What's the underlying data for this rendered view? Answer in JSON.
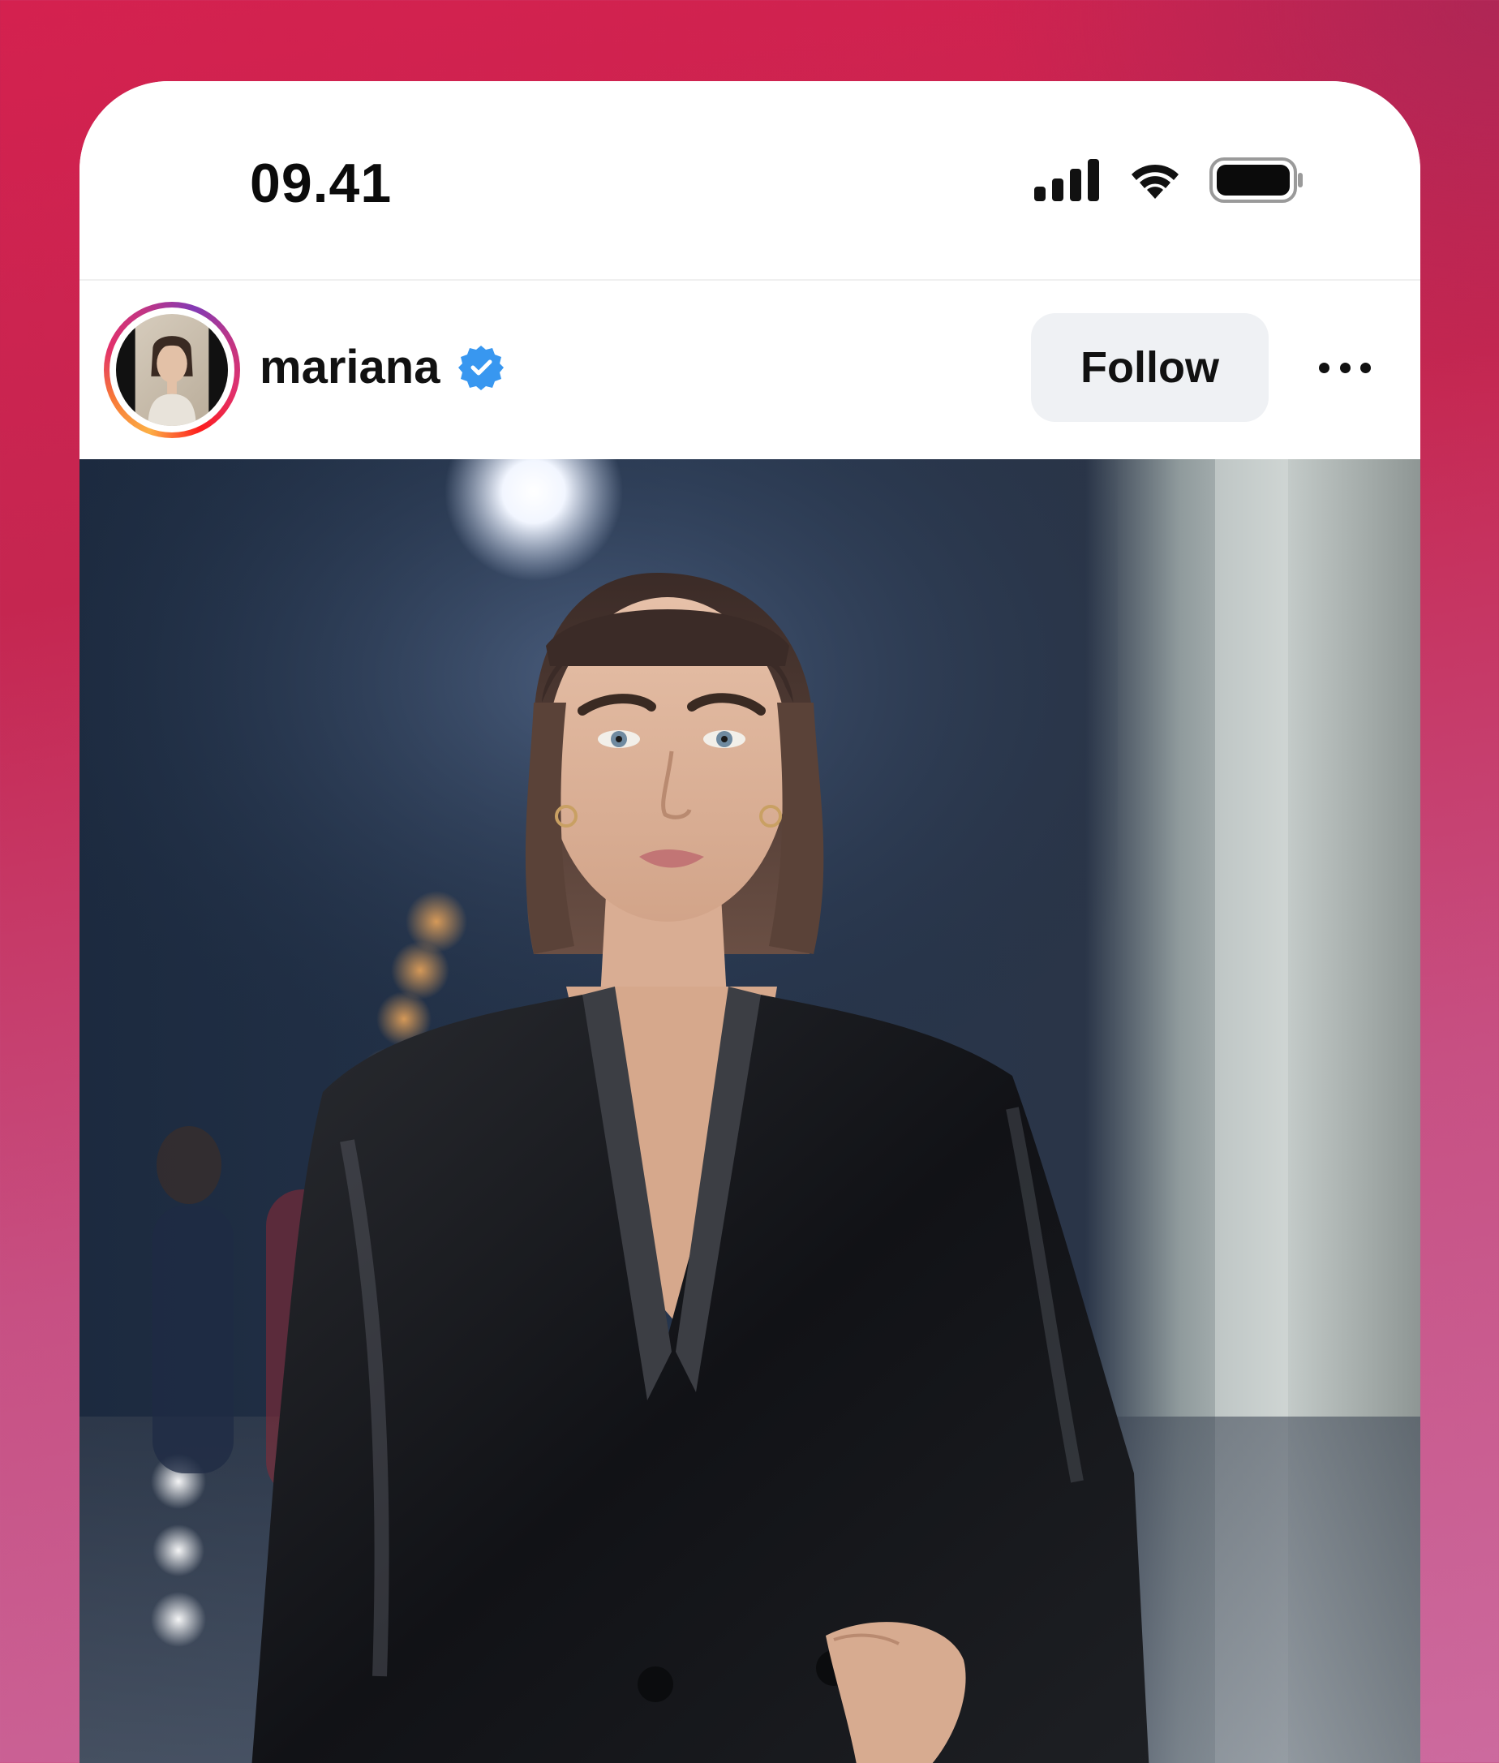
{
  "status_bar": {
    "time": "09.41",
    "icons": [
      "cellular-signal-icon",
      "wifi-icon",
      "battery-icon"
    ]
  },
  "post": {
    "username": "mariana",
    "verified": true,
    "follow_label": "Follow",
    "more_icon": "more-horizontal-icon",
    "avatar_ring_colors": [
      "#fcaf45",
      "#f77737",
      "#e1306c",
      "#c13584",
      "#833ab4"
    ]
  },
  "colors": {
    "background_top": "#d4214f",
    "background_bottom": "#cc6a9e",
    "verified_badge": "#3897f0",
    "follow_button_bg": "#eff1f4"
  }
}
